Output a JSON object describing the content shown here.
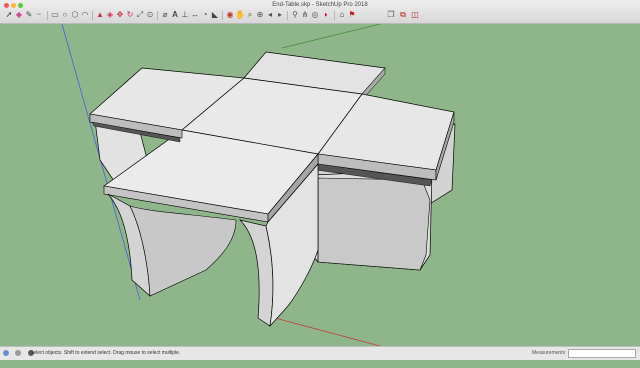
{
  "window": {
    "title": "End-Table.skp - SketchUp Pro 2018",
    "traffic_lights": [
      "#ee5b53",
      "#f5b83a",
      "#5fc53e"
    ]
  },
  "toolbar": {
    "icons": [
      "select-arrow-icon",
      "eraser-icon",
      "pencil-line-icon",
      "freehand-icon",
      "rectangle-icon",
      "circle-icon",
      "polygon-icon",
      "arc-icon",
      "push-pull-icon",
      "offset-icon",
      "move-icon",
      "rotate-icon",
      "scale-icon",
      "follow-me-icon",
      "tape-measure-icon",
      "text-icon",
      "axes-icon",
      "dimension-icon",
      "protractor-icon",
      "paint-bucket-icon",
      "orbit-icon",
      "pan-icon",
      "zoom-icon",
      "zoom-extents-icon",
      "previous-view-icon",
      "next-view-icon",
      "position-camera-icon",
      "walk-icon",
      "look-around-icon",
      "section-plane-icon",
      "3d-warehouse-icon",
      "extension-warehouse-icon",
      "layout-icon",
      "extension-manager-icon"
    ]
  },
  "palette": {
    "icons": [
      "select-arrow-icon",
      "paint-bucket-icon",
      "eraser-icon",
      "orbit-icon"
    ]
  },
  "status_bar": {
    "icons": [
      "geo-location-icon",
      "credits-icon",
      "help-icon"
    ],
    "message": "Select objects. Shift to extend select. Drag mouse to select multiple.",
    "measurements_label": "Measurements",
    "measurements_value": ""
  },
  "viewport": {
    "background_color": "#8fb68a",
    "model": "end-table"
  }
}
